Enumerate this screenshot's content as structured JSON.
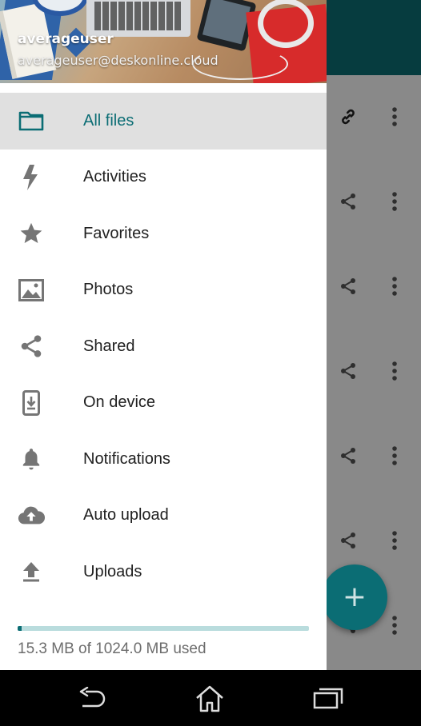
{
  "colors": {
    "primary": "#0b6d74",
    "active_bg": "#e0e0e0",
    "icon_gray": "#757575",
    "quota_track": "#b9dcdd"
  },
  "drawer": {
    "user": {
      "name": "averageuser",
      "email": "averageuser@deskonline.cloud"
    },
    "items": [
      {
        "label": "All files",
        "icon": "folder-icon",
        "active": true
      },
      {
        "label": "Activities",
        "icon": "lightning-icon",
        "active": false
      },
      {
        "label": "Favorites",
        "icon": "star-icon",
        "active": false
      },
      {
        "label": "Photos",
        "icon": "image-icon",
        "active": false
      },
      {
        "label": "Shared",
        "icon": "share-icon",
        "active": false
      },
      {
        "label": "On device",
        "icon": "phone-download-icon",
        "active": false
      },
      {
        "label": "Notifications",
        "icon": "bell-icon",
        "active": false
      },
      {
        "label": "Auto upload",
        "icon": "cloud-upload-icon",
        "active": false
      },
      {
        "label": "Uploads",
        "icon": "upload-icon",
        "active": false
      }
    ],
    "quota": {
      "text": "15.3 MB of 1024.0 MB used",
      "used_fraction": 0.015
    }
  },
  "background_list": {
    "row_actions": [
      "link-icon",
      "share-icon",
      "share-icon",
      "share-icon",
      "share-icon",
      "share-icon",
      "share-icon"
    ]
  },
  "fab": {
    "icon": "plus-icon"
  },
  "navbar": {
    "buttons": [
      "back-icon",
      "home-icon",
      "recent-apps-icon"
    ]
  }
}
